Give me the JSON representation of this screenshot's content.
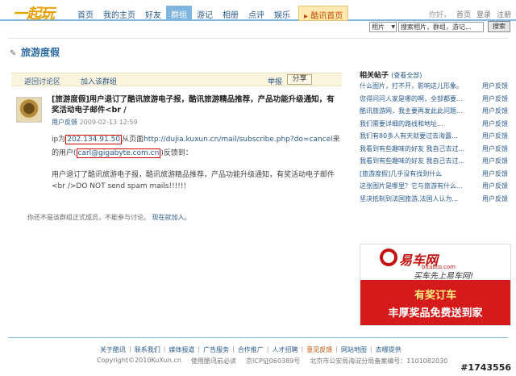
{
  "header": {
    "logo": "一起玩",
    "nav": [
      "首页",
      "我的主页",
      "好友",
      "群组",
      "游记",
      "相册",
      "点评",
      "娱乐"
    ],
    "hot_link": "酷讯首页",
    "user_links": [
      "你好，",
      "首页",
      "登录",
      "注册"
    ]
  },
  "search": {
    "select_value": "相片",
    "placeholder": "搜索相片，群组，游记...",
    "button": "搜索"
  },
  "page_title": "旅游度假",
  "group_bar": {
    "back": "返回讨论区",
    "join": "加入该群组",
    "report": "举报",
    "share": "分享"
  },
  "post": {
    "title": "[旅游度假]用户退订了酷讯旅游电子报，酷讯旅游精品推荐，产品功能升级通知，有奖活动电子邮件<br /",
    "category": "用户反馈",
    "date": "2009-02-13 12:59",
    "line1_a": "ip为",
    "ip": "202.134.91.50",
    "line1_b": "从页面",
    "url": "http://dujia.kuxun.cn/mail/subscribe.php?do=cancel",
    "line1_c": "来",
    "line2_a": "的用户(",
    "email": "carl@gigabyte.com.cn",
    "line2_b": ")反馈到：",
    "body": "用户退订了酷讯旅游电子报，酷讯旅游精品推荐，产品功能升级通知，有奖活动电子邮件<br />DO NOT send spam mails!!!!!!",
    "notice": "你还不是该群组正式成员，不能参与讨论。",
    "notice_link": "现在就加入。"
  },
  "related": {
    "title": "相关帖子",
    "more": "(查看全部)",
    "items": [
      {
        "text": "什么图片，打不开，影响这儿形象。",
        "tag": "用户反馈"
      },
      {
        "text": "您得问问人家是哪的啊，全部都要...",
        "tag": "用户反馈"
      },
      {
        "text": "酷讯旅游网，我主要再发此此问题...",
        "tag": "用户反馈"
      },
      {
        "text": "我们需要详细的路线和地址...",
        "tag": "用户反馈"
      },
      {
        "text": "我们有80多人有天就要过去海露...",
        "tag": "用户反馈"
      },
      {
        "text": "我看到有些趣味的好友 我自己去过...",
        "tag": "用户反馈"
      },
      {
        "text": "我看到有些趣味的好友 我自己去过...",
        "tag": "用户反馈"
      },
      {
        "text": "[旅游度假]几乎没有找到什么",
        "tag": "用户反馈"
      },
      {
        "text": "这张图片是哪里？它与旅游有什么...",
        "tag": "用户反馈"
      },
      {
        "text": "坚决抵制到法国旅游,法国人认为...",
        "tag": "用户反馈"
      }
    ]
  },
  "ad": {
    "logo": "易车网",
    "logo_sub": "bitauto.com",
    "slogan": "买车先上易车网!",
    "line1": "有奖订车",
    "line2": "丰厚奖品免费送到家"
  },
  "footer": {
    "links": [
      "关于酷讯",
      "联系我们",
      "媒体报道",
      "广告服务",
      "合作推广",
      "人才招聘",
      "意见反馈",
      "网站地图",
      "去哪提供"
    ],
    "copy": [
      "Copyright©2010KuXun.cn",
      "使用酷讯前必读",
      "京ICP证060389号",
      "北京市公安局海淀分局备案编号：1101082030"
    ]
  },
  "watermark": "#1743556"
}
